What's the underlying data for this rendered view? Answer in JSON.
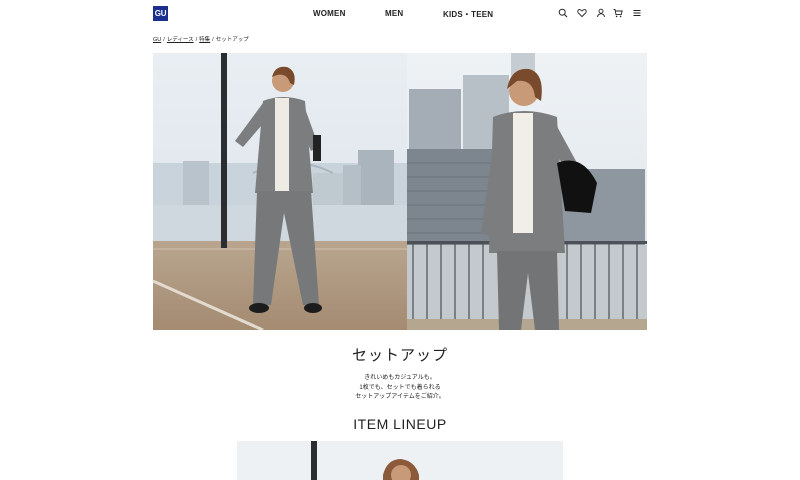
{
  "header": {
    "logo": "GU",
    "nav": [
      "WOMEN",
      "MEN",
      "KIDS・TEEN"
    ],
    "icons": [
      "search-icon",
      "heart-icon",
      "user-icon",
      "cart-icon",
      "menu-icon"
    ]
  },
  "breadcrumb": [
    {
      "label": "GU",
      "link": true
    },
    {
      "label": "レディース",
      "link": true
    },
    {
      "label": "特集",
      "link": true
    },
    {
      "label": "セットアップ",
      "link": false
    }
  ],
  "breadcrumb_separator": "/",
  "feature": {
    "title": "セットアップ",
    "lead": [
      "きれいめもカジュアルも。",
      "1枚でも、セットでも着られる",
      "セットアップアイテムをご紹介。"
    ]
  },
  "lineup": {
    "title": "ITEM LINEUP"
  },
  "colors": {
    "brand": "#1b2f8f",
    "text": "#222222",
    "suit": "#7b7d7f"
  }
}
